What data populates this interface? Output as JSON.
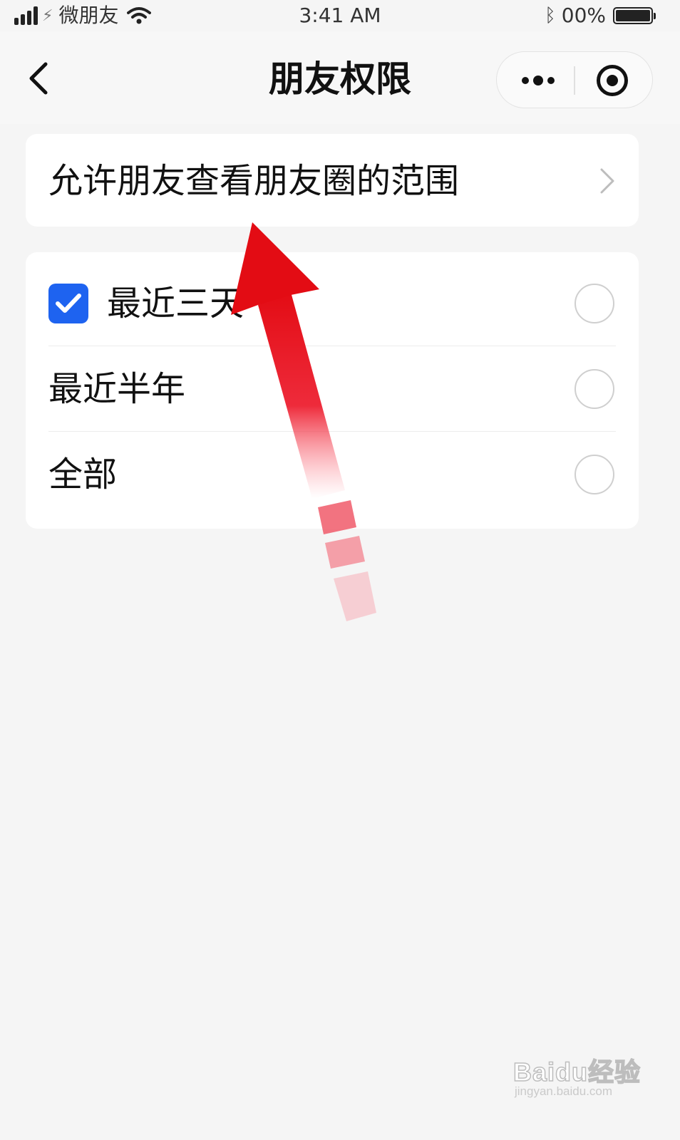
{
  "status_bar": {
    "carrier": "微朋友",
    "time": "3:41 AM",
    "battery_text": "00%"
  },
  "nav": {
    "title": "朋友权限"
  },
  "scope": {
    "label": "允许朋友查看朋友圈的范围"
  },
  "options": [
    {
      "label": "最近三天",
      "checked": true
    },
    {
      "label": "最近半年",
      "checked": false
    },
    {
      "label": "全部",
      "checked": false
    }
  ],
  "watermark": {
    "brand": "Baidu经验",
    "url": "jingyan.baidu.com"
  },
  "colors": {
    "accent": "#1e63f0",
    "arrow": "#e8141d",
    "background": "#f5f5f5"
  }
}
